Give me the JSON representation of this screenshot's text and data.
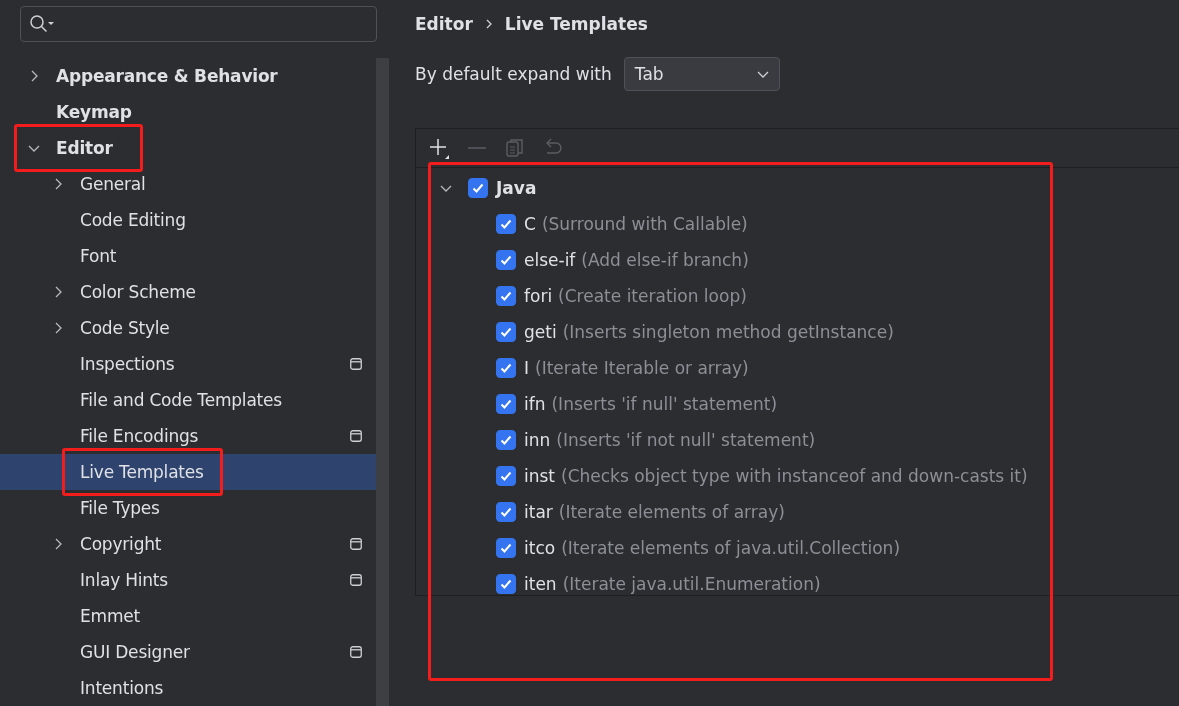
{
  "sidebar": {
    "items": [
      {
        "label": "Appearance & Behavior",
        "expanded": false,
        "selected": false,
        "highlighted": false,
        "project_scope": false
      },
      {
        "label": "Keymap",
        "selected": false,
        "highlighted": false,
        "project_scope": false
      },
      {
        "label": "Editor",
        "expanded": true,
        "selected": false,
        "highlighted": true,
        "project_scope": false,
        "children": [
          {
            "label": "General",
            "expanded": false,
            "selected": false,
            "highlighted": false,
            "project_scope": false
          },
          {
            "label": "Code Editing",
            "selected": false,
            "highlighted": false,
            "project_scope": false
          },
          {
            "label": "Font",
            "selected": false,
            "highlighted": false,
            "project_scope": false
          },
          {
            "label": "Color Scheme",
            "expanded": false,
            "selected": false,
            "highlighted": false,
            "project_scope": false
          },
          {
            "label": "Code Style",
            "expanded": false,
            "selected": false,
            "highlighted": false,
            "project_scope": false
          },
          {
            "label": "Inspections",
            "selected": false,
            "highlighted": false,
            "project_scope": true
          },
          {
            "label": "File and Code Templates",
            "selected": false,
            "highlighted": false,
            "project_scope": false
          },
          {
            "label": "File Encodings",
            "selected": false,
            "highlighted": false,
            "project_scope": true
          },
          {
            "label": "Live Templates",
            "selected": true,
            "highlighted": true,
            "project_scope": false
          },
          {
            "label": "File Types",
            "selected": false,
            "highlighted": false,
            "project_scope": false
          },
          {
            "label": "Copyright",
            "expanded": false,
            "selected": false,
            "highlighted": false,
            "project_scope": true
          },
          {
            "label": "Inlay Hints",
            "selected": false,
            "highlighted": false,
            "project_scope": true
          },
          {
            "label": "Emmet",
            "selected": false,
            "highlighted": false,
            "project_scope": false
          },
          {
            "label": "GUI Designer",
            "selected": false,
            "highlighted": false,
            "project_scope": true
          },
          {
            "label": "Intentions",
            "selected": false,
            "highlighted": false,
            "project_scope": false
          }
        ]
      }
    ]
  },
  "breadcrumb": [
    "Editor",
    "Live Templates"
  ],
  "expand_with": {
    "label": "By default expand with",
    "value": "Tab"
  },
  "templates": {
    "highlighted": true,
    "groups": [
      {
        "name": "Java",
        "expanded": true,
        "checked": true,
        "templates": [
          {
            "abbreviation": "C",
            "description": "(Surround with Callable)",
            "checked": true
          },
          {
            "abbreviation": "else-if",
            "description": "(Add else-if branch)",
            "checked": true
          },
          {
            "abbreviation": "fori",
            "description": "(Create iteration loop)",
            "checked": true
          },
          {
            "abbreviation": "geti",
            "description": "(Inserts singleton method getInstance)",
            "checked": true
          },
          {
            "abbreviation": "I",
            "description": "(Iterate Iterable or array)",
            "checked": true
          },
          {
            "abbreviation": "ifn",
            "description": "(Inserts 'if null' statement)",
            "checked": true
          },
          {
            "abbreviation": "inn",
            "description": "(Inserts 'if not null' statement)",
            "checked": true
          },
          {
            "abbreviation": "inst",
            "description": "(Checks object type with instanceof and down-casts it)",
            "checked": true
          },
          {
            "abbreviation": "itar",
            "description": "(Iterate elements of array)",
            "checked": true
          },
          {
            "abbreviation": "itco",
            "description": "(Iterate elements of java.util.Collection)",
            "checked": true
          },
          {
            "abbreviation": "iten",
            "description": "(Iterate java.util.Enumeration)",
            "checked": true
          }
        ]
      }
    ]
  }
}
